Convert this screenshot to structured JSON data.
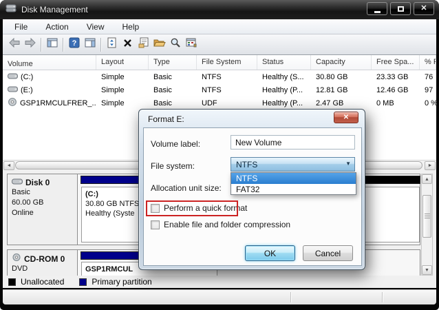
{
  "window": {
    "title": "Disk Management"
  },
  "glyphs": {
    "close": "✕",
    "left_arrow": "◄",
    "right_arrow": "►",
    "up_arrow": "▲",
    "down_arrow": "▼",
    "combo_arrow": "▼",
    "question": "?"
  },
  "menu_bar": {
    "items": [
      {
        "label": "File"
      },
      {
        "label": "Action"
      },
      {
        "label": "View"
      },
      {
        "label": "Help"
      }
    ]
  },
  "toolbar": {
    "icons": [
      "back",
      "forward",
      "show-console-tree",
      "help",
      "show-action-pane",
      "refresh",
      "delete",
      "properties",
      "open-folder",
      "zoom",
      "disk-events"
    ]
  },
  "volume_list": {
    "columns": [
      {
        "label": "Volume"
      },
      {
        "label": "Layout"
      },
      {
        "label": "Type"
      },
      {
        "label": "File System"
      },
      {
        "label": "Status"
      },
      {
        "label": "Capacity"
      },
      {
        "label": "Free Spa..."
      },
      {
        "label": "% F"
      }
    ],
    "rows": [
      {
        "icon": "drive-icon",
        "volume": "(C:)",
        "layout": "Simple",
        "type": "Basic",
        "file_system": "NTFS",
        "status": "Healthy (S...",
        "capacity": "30.80 GB",
        "free_space": "23.33 GB",
        "percent_free": "76"
      },
      {
        "icon": "drive-icon",
        "volume": "(E:)",
        "layout": "Simple",
        "type": "Basic",
        "file_system": "NTFS",
        "status": "Healthy (P...",
        "capacity": "12.81 GB",
        "free_space": "12.46 GB",
        "percent_free": "97"
      },
      {
        "icon": "cd-icon",
        "volume": "GSP1RMCULFRER_...",
        "layout": "Simple",
        "type": "Basic",
        "file_system": "UDF",
        "status": "Healthy (P...",
        "capacity": "2.47 GB",
        "free_space": "0 MB",
        "percent_free": "0 %"
      }
    ]
  },
  "disk_pane": {
    "disk0": {
      "title": "Disk 0",
      "lines": [
        "Basic",
        "60.00 GB",
        "Online"
      ],
      "partition_c": {
        "name": "(C:)",
        "line2": "30.80 GB NTFS",
        "line3": "Healthy (Syste"
      }
    },
    "cdrom0": {
      "title": "CD-ROM 0",
      "lines": [
        "DVD"
      ],
      "partition": {
        "name": "GSP1RMCUL"
      }
    },
    "legend": [
      {
        "label": "Unallocated",
        "color": "#000000"
      },
      {
        "label": "Primary partition",
        "color": "#00008B"
      }
    ]
  },
  "format_dialog": {
    "title": "Format E:",
    "volume_label_field": {
      "label": "Volume label:",
      "value": "New Volume"
    },
    "file_system_field": {
      "label": "File system:",
      "value": "NTFS"
    },
    "allocation_field": {
      "label": "Allocation unit size:"
    },
    "dropdown_options": [
      {
        "label": "NTFS",
        "selected": true
      },
      {
        "label": "FAT32",
        "selected": false
      }
    ],
    "checkboxes": [
      {
        "label": "Perform a quick format",
        "checked": false,
        "highlighted": true
      },
      {
        "label": "Enable file and folder compression",
        "checked": false
      }
    ],
    "ok_label": "OK",
    "cancel_label": "Cancel"
  },
  "colors": {
    "primary_partition": "#00008B",
    "unallocated": "#000000",
    "selected_item": "#3399FF",
    "annotation_red": "#CC2222",
    "close_button_red": "#C0564A"
  }
}
